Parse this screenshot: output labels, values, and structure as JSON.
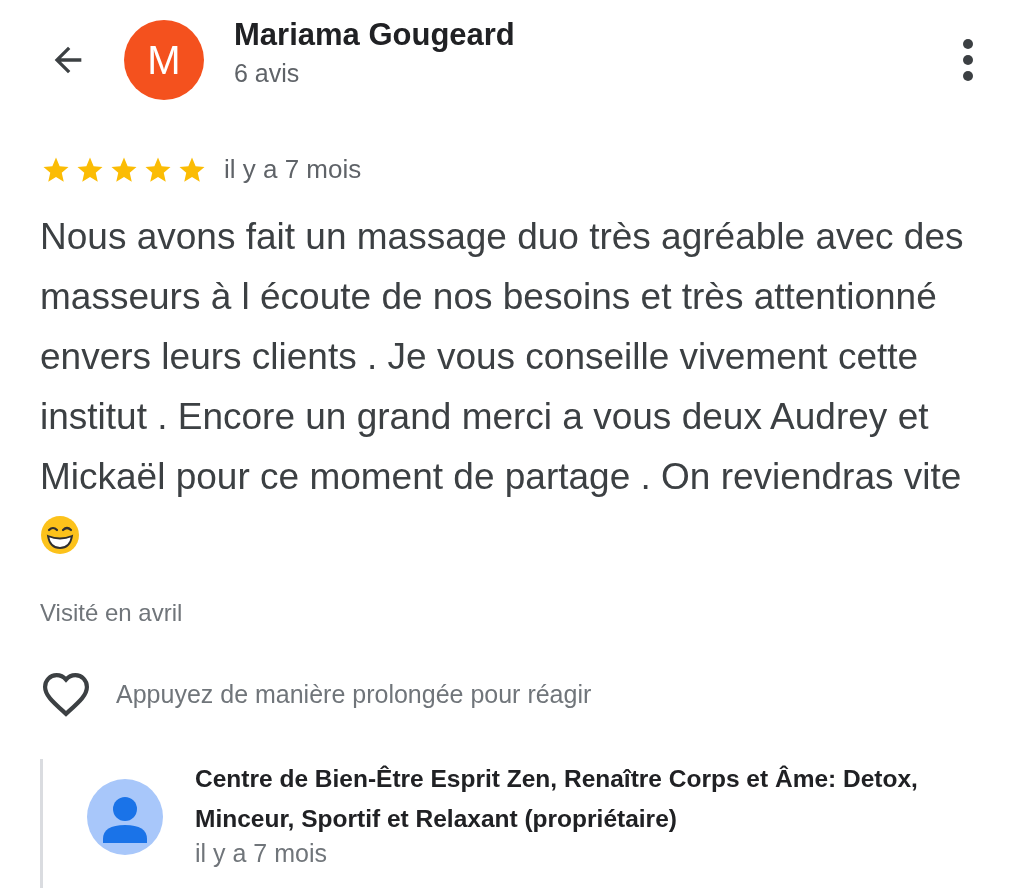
{
  "header": {
    "avatar_letter": "M",
    "name": "Mariama Gougeard",
    "subtitle": "6 avis"
  },
  "review": {
    "stars": 5,
    "time": "il y a 7 mois",
    "text": "Nous avons fait un massage duo très agréable avec des masseurs à l écoute de nos besoins et très attentionné envers leurs clients . Je vous conseille vivement cette institut . Encore un grand merci a vous deux Audrey et Mickaël pour ce moment de partage . On reviendras vite",
    "visited": "Visité en avril",
    "react_hint": "Appuyez de manière prolongée pour réagir"
  },
  "owner_reply": {
    "name": "Centre de Bien-Être Esprit Zen, Renaître Corps et Âme: Detox, Minceur, Sportif et Relaxant (propriétaire)",
    "time": "il y a 7 mois"
  }
}
